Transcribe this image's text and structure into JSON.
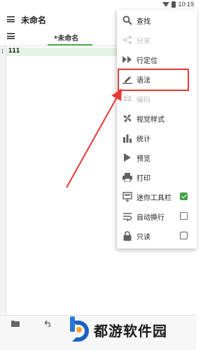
{
  "status_bar": {
    "time": "10:19"
  },
  "app_bar": {
    "title": "未命名"
  },
  "tabs": [
    {
      "label": "*未命名",
      "active": true
    }
  ],
  "editor": {
    "lines": [
      {
        "number": "1",
        "text": "111"
      }
    ]
  },
  "menu": {
    "items": [
      {
        "label": "查找",
        "icon": "search-icon",
        "enabled": true
      },
      {
        "label": "分享",
        "icon": "share-icon",
        "enabled": false
      },
      {
        "label": "行定位",
        "icon": "goto-line-icon",
        "enabled": true
      },
      {
        "label": "语法",
        "icon": "pen-icon",
        "enabled": true,
        "highlighted": true
      },
      {
        "label": "编码",
        "icon": "encoding-icon",
        "enabled": false
      },
      {
        "label": "视觉样式",
        "icon": "fan-icon",
        "enabled": true
      },
      {
        "label": "统计",
        "icon": "bar-chart-icon",
        "enabled": true
      },
      {
        "label": "预览",
        "icon": "play-icon",
        "enabled": true
      },
      {
        "label": "打印",
        "icon": "printer-icon",
        "enabled": true
      },
      {
        "label": "迷你工具栏",
        "icon": "mini-toolbar-icon",
        "enabled": true,
        "checkbox": true,
        "checked": true
      },
      {
        "label": "自动换行",
        "icon": "wrap-icon",
        "enabled": true,
        "checkbox": true,
        "checked": false
      },
      {
        "label": "只读",
        "icon": "lock-icon",
        "enabled": true,
        "checkbox": true,
        "checked": false
      }
    ]
  },
  "watermark": {
    "text": "都游软件园"
  },
  "colors": {
    "accent_green": "#4caf50",
    "highlight_red": "#e53935",
    "line_highlight": "#e3f2e4",
    "watermark_blue": "#1d5fc4",
    "watermark_orange": "#f5a623"
  }
}
